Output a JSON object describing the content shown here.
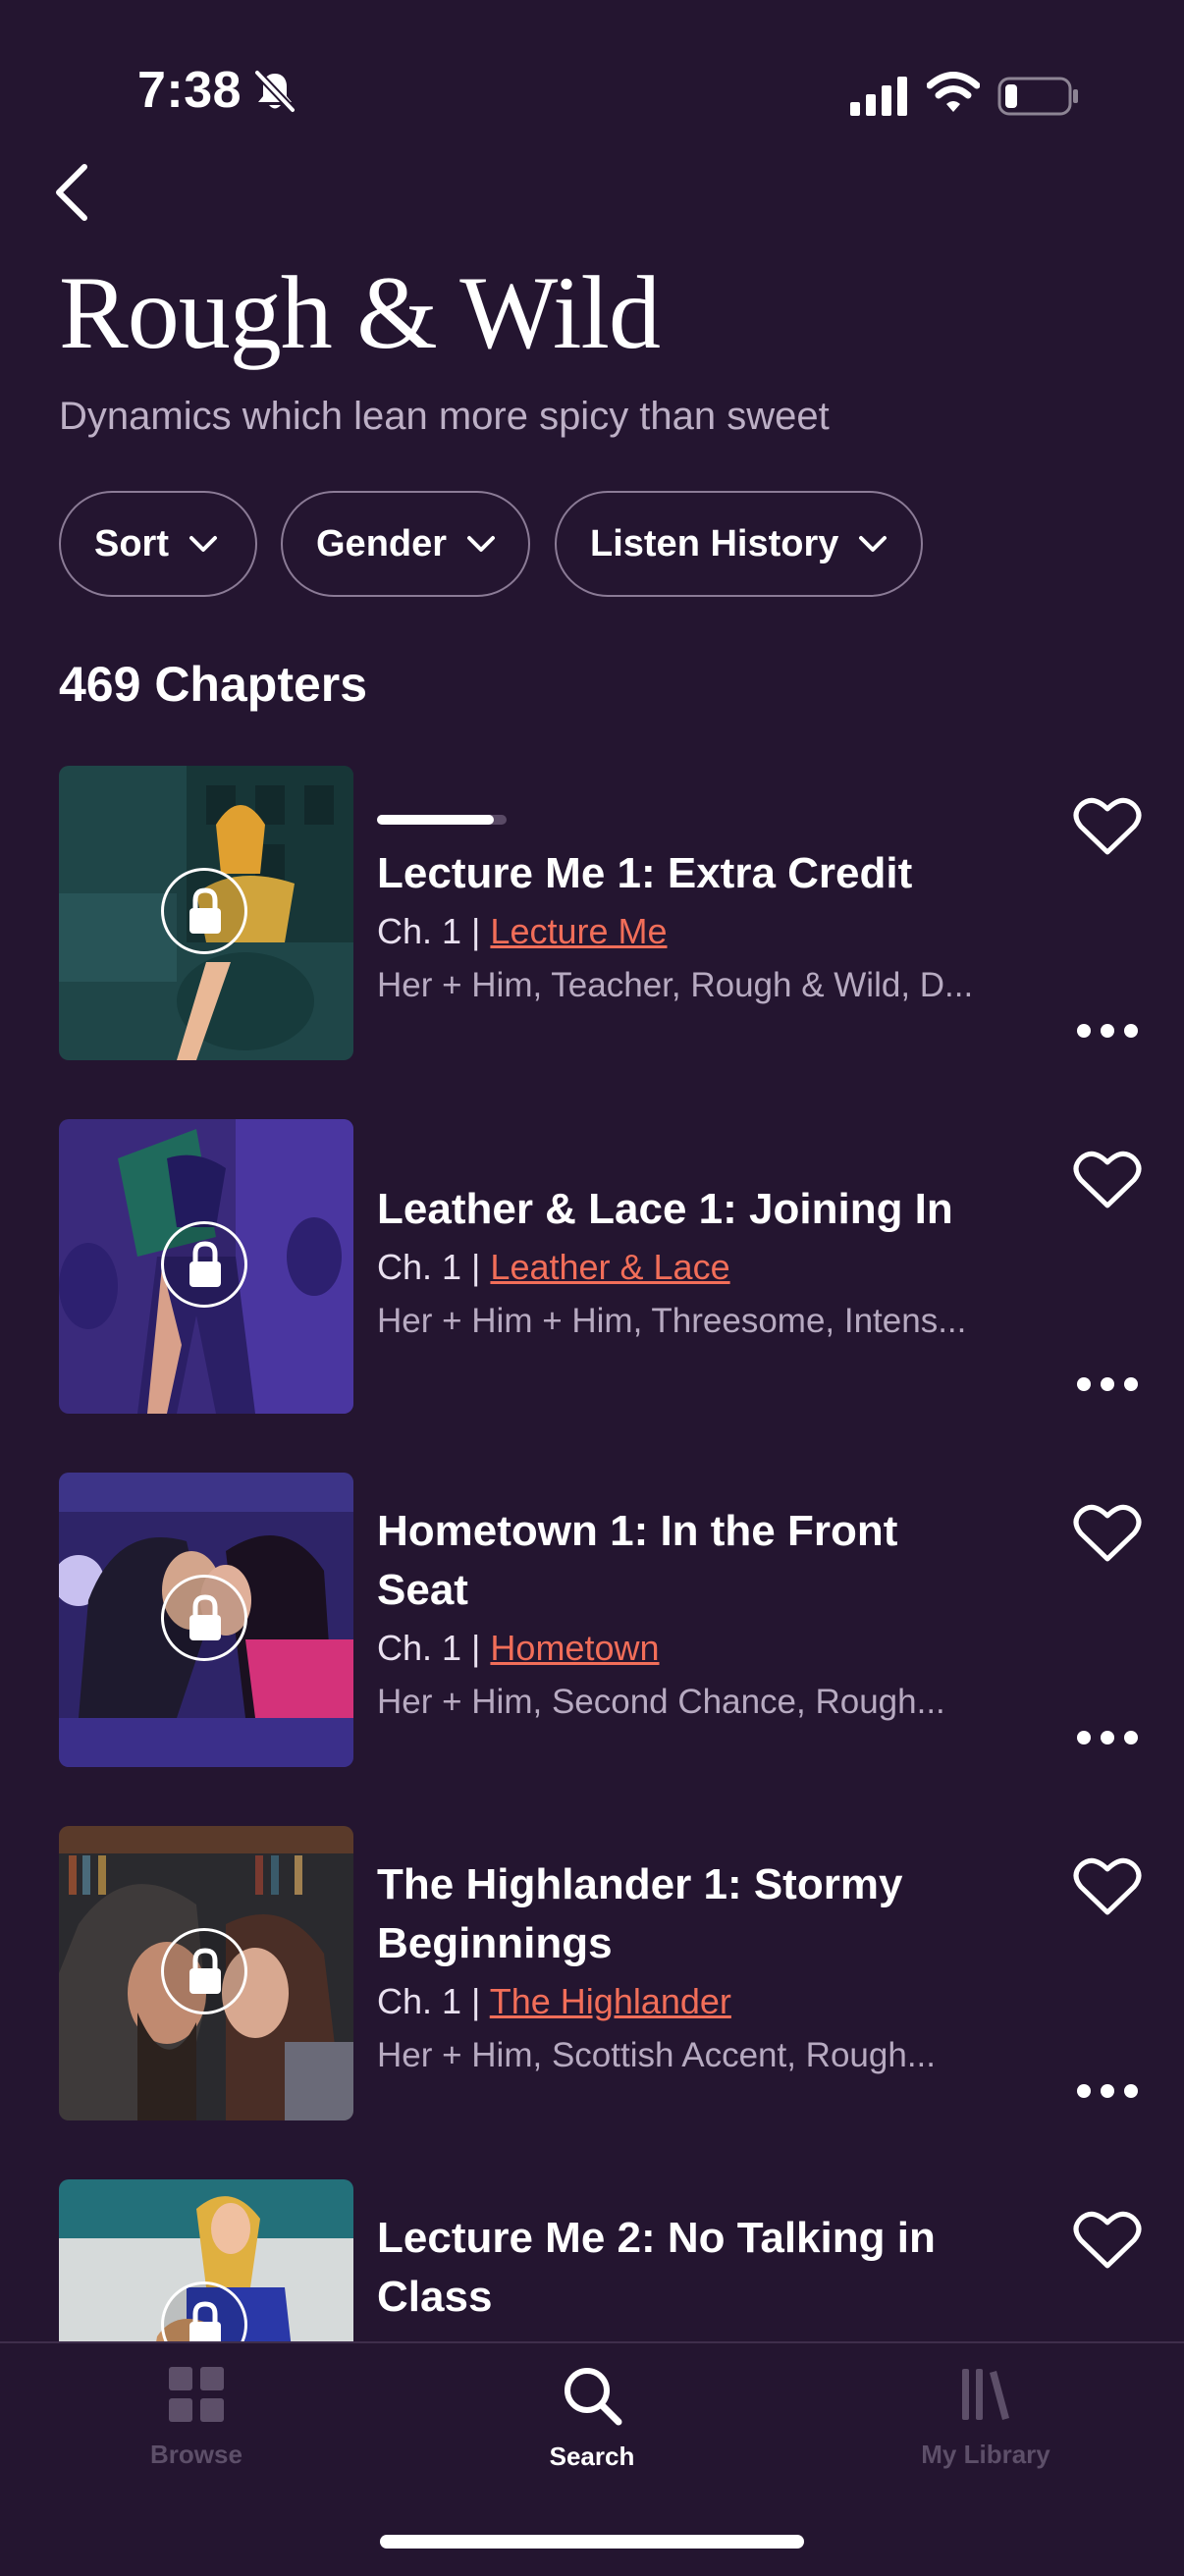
{
  "status_bar": {
    "time": "7:38",
    "icons": [
      "bell-slash-icon",
      "cellular-signal-icon",
      "wifi-icon",
      "battery-icon"
    ]
  },
  "header": {
    "back_icon": "chevron-left-icon",
    "title": "Rough & Wild",
    "subtitle": "Dynamics which lean more spicy than sweet"
  },
  "filters": [
    {
      "label": "Sort",
      "icon": "chevron-down-icon"
    },
    {
      "label": "Gender",
      "icon": "chevron-down-icon"
    },
    {
      "label": "Listen History",
      "icon": "chevron-down-icon"
    }
  ],
  "chapter_count": "469 Chapters",
  "chapters": [
    {
      "title": "Lecture Me 1: Extra Credit",
      "chapter": "Ch. 1 |",
      "series": "Lecture Me",
      "tags": "Her + Him, Teacher, Rough & Wild, D...",
      "progress": 0.9,
      "locked": true
    },
    {
      "title": "Leather & Lace 1: Joining In",
      "chapter": "Ch. 1 |",
      "series": "Leather & Lace",
      "tags": "Her + Him + Him, Threesome, Intens...",
      "locked": true
    },
    {
      "title": "Hometown 1: In the Front Seat",
      "chapter": "Ch. 1 |",
      "series": "Hometown",
      "tags": "Her + Him, Second Chance, Rough...",
      "locked": true
    },
    {
      "title": "The Highlander 1: Stormy Beginnings",
      "chapter": "Ch. 1 |",
      "series": "The Highlander",
      "tags": "Her + Him, Scottish Accent, Rough...",
      "locked": true
    },
    {
      "title": "Lecture Me 2: No Talking in Class",
      "locked": true
    }
  ],
  "tabbar": {
    "tabs": [
      {
        "label": "Browse",
        "icon": "grid-icon",
        "active": false
      },
      {
        "label": "Search",
        "icon": "search-icon",
        "active": true
      },
      {
        "label": "My Library",
        "icon": "library-icon",
        "active": false
      }
    ]
  },
  "colors": {
    "background": "#241530",
    "link": "#f26e59",
    "inactive_tab": "#5d4f69",
    "muted_text": "#b7aac1"
  }
}
